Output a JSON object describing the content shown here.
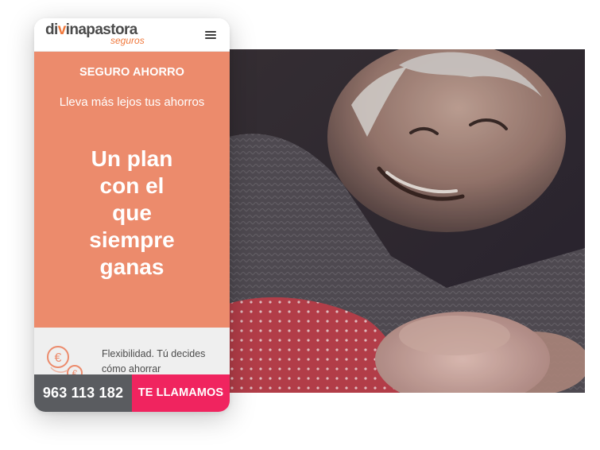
{
  "brand": {
    "logo_prefix": "di",
    "logo_accent": "v",
    "logo_suffix": "inapastora",
    "logo_sub": "seguros",
    "accent_color": "#f0783c"
  },
  "header": {
    "menu_icon": "hamburger-menu-icon"
  },
  "hero": {
    "eyebrow": "SEGURO AHORRO",
    "subtitle": "Lleva más lejos tus ahorros",
    "title_lines": [
      "Un plan",
      "con el",
      "que",
      "siempre",
      "ganas"
    ],
    "background_color": "#ec8b6c"
  },
  "feature": {
    "icon": "euro-coins-icon",
    "text": "Flexibilidad. Tú decides cómo ahorrar"
  },
  "cta": {
    "phone_number": "963 113 182",
    "call_label": "TE LLAMAMOS",
    "phone_color": "#5a5c60",
    "call_color": "#f0245f"
  },
  "photo": {
    "subject": "elderly-man-with-baby-photo"
  }
}
